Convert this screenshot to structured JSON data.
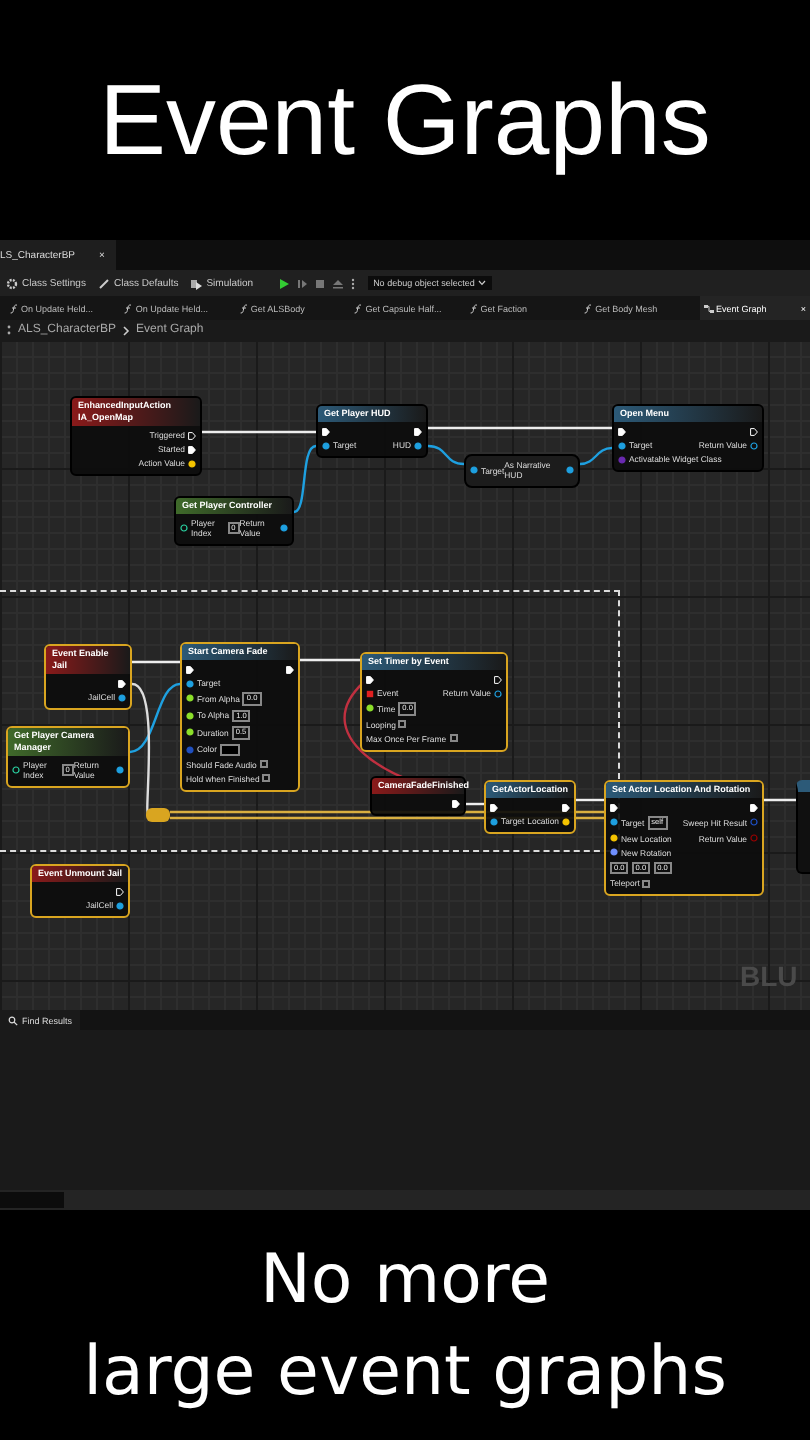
{
  "caption_top": "Event Graphs",
  "editor": {
    "document_tab": {
      "label": "LS_CharacterBP",
      "close": "×",
      "selected": true
    },
    "toolbar": {
      "buttons": [
        "Class Settings",
        "Class Defaults",
        "Simulation"
      ],
      "debug_dropdown": "No debug object selected"
    },
    "graph_tabs": [
      {
        "label": "On Update Held...",
        "kind": "function",
        "selected": false
      },
      {
        "label": "On Update Held...",
        "kind": "function",
        "selected": false
      },
      {
        "label": "Get ALSBody",
        "kind": "function",
        "selected": false
      },
      {
        "label": "Get Capsule Half...",
        "kind": "function",
        "selected": false
      },
      {
        "label": "Get Faction",
        "kind": "function",
        "selected": false
      },
      {
        "label": "Get Body Mesh",
        "kind": "function",
        "selected": false
      },
      {
        "label": "Event Graph",
        "kind": "graph",
        "selected": true,
        "close": "×"
      }
    ],
    "breadcrumb": [
      "ALS_CharacterBP",
      "Event Graph"
    ],
    "graph": {
      "nodes": [
        {
          "kind": "event",
          "title": "EnhancedInputAction IA_OpenMap",
          "rows": [
            {
              "right": {
                "kind": "exec_hollow",
                "label": "Triggered"
              }
            },
            {
              "right": {
                "kind": "exec",
                "label": "Started"
              }
            },
            {
              "right": {
                "kind": "struct",
                "label": "Action Value"
              }
            }
          ]
        },
        {
          "kind": "function",
          "title": "Get Player HUD",
          "rows": [
            {
              "left": {
                "kind": "exec"
              },
              "right": {
                "kind": "exec"
              }
            },
            {
              "left": {
                "kind": "object",
                "label": "Target"
              },
              "right": {
                "kind": "object",
                "label": "HUD"
              }
            }
          ]
        },
        {
          "kind": "function",
          "title": "Open Menu",
          "rows": [
            {
              "left": {
                "kind": "exec"
              },
              "right": {
                "kind": "exec_hollow"
              }
            },
            {
              "left": {
                "kind": "object",
                "label": "Target"
              },
              "right": {
                "kind": "object_hollow",
                "label": "Return Value"
              }
            },
            {
              "left": {
                "kind": "class",
                "label": "Activatable Widget Class"
              }
            }
          ]
        },
        {
          "kind": "compact",
          "rows": [
            {
              "left": {
                "kind": "object",
                "label": "Target"
              },
              "right": {
                "kind": "object",
                "label": "As Narrative HUD"
              }
            }
          ]
        },
        {
          "kind": "pure",
          "title": "Get Player Controller",
          "rows": [
            {
              "left": {
                "kind": "int_hollow",
                "label": "Player Index",
                "value": "0"
              },
              "right": {
                "kind": "object",
                "label": "Return Value"
              }
            }
          ]
        },
        {
          "kind": "event",
          "title": "Event Enable Jail",
          "rows": [
            {
              "right": {
                "kind": "exec"
              }
            },
            {
              "right": {
                "kind": "object",
                "label": "JailCell"
              }
            }
          ]
        },
        {
          "kind": "pure",
          "title": "Get Player Camera Manager",
          "rows": [
            {
              "left": {
                "kind": "int_hollow",
                "label": "Player Index",
                "value": "0"
              },
              "right": {
                "kind": "object",
                "label": "Return Value"
              }
            }
          ]
        },
        {
          "kind": "function",
          "title": "Start Camera Fade",
          "rows": [
            {
              "left": {
                "kind": "exec"
              },
              "right": {
                "kind": "exec"
              }
            },
            {
              "left": {
                "kind": "object",
                "label": "Target"
              }
            },
            {
              "left": {
                "kind": "float",
                "label": "From Alpha",
                "value": "0.0"
              }
            },
            {
              "left": {
                "kind": "float",
                "label": "To Alpha",
                "value": "1.0"
              }
            },
            {
              "left": {
                "kind": "float",
                "label": "Duration",
                "value": "0.5"
              }
            },
            {
              "left": {
                "kind": "color",
                "label": "Color"
              }
            },
            {
              "left": {
                "kind": "bool",
                "label": "Should Fade Audio",
                "checked": false
              }
            },
            {
              "left": {
                "kind": "bool",
                "label": "Hold when Finished",
                "checked": false
              }
            }
          ]
        },
        {
          "kind": "function",
          "title": "Set Timer by Event",
          "rows": [
            {
              "left": {
                "kind": "exec"
              },
              "right": {
                "kind": "exec_hollow"
              }
            },
            {
              "left": {
                "kind": "delegate",
                "label": "Event"
              },
              "right": {
                "kind": "object_hollow",
                "label": "Return Value"
              }
            },
            {
              "left": {
                "kind": "float",
                "label": "Time",
                "value": "0.0"
              }
            },
            {
              "left": {
                "kind": "bool",
                "label": "Looping",
                "checked": false
              }
            },
            {
              "left": {
                "kind": "bool",
                "label": "Max Once Per Frame",
                "checked": false
              }
            }
          ]
        },
        {
          "kind": "event",
          "title": "CameraFadeFinished",
          "rows": [
            {
              "right": {
                "kind": "exec"
              }
            }
          ]
        },
        {
          "kind": "function",
          "title": "GetActorLocation",
          "rows": [
            {
              "left": {
                "kind": "exec"
              },
              "right": {
                "kind": "exec"
              }
            },
            {
              "left": {
                "kind": "object",
                "label": "Target"
              },
              "right": {
                "kind": "struct",
                "label": "Location"
              }
            }
          ]
        },
        {
          "kind": "function",
          "title": "Set Actor Location And Rotation",
          "rows": [
            {
              "left": {
                "kind": "exec"
              },
              "right": {
                "kind": "exec"
              }
            },
            {
              "left": {
                "kind": "object",
                "label": "Target",
                "value": "self"
              },
              "right": {
                "kind": "struct_hollow",
                "label": "Sweep Hit Result"
              }
            },
            {
              "left": {
                "kind": "struct",
                "label": "New Location"
              },
              "right": {
                "kind": "bool_hollow",
                "label": "Return Value"
              }
            },
            {
              "left": {
                "kind": "rotator",
                "label": "New Rotation"
              }
            },
            {
              "left": {
                "kind": "rotator_values",
                "values": [
                  "0.0",
                  "0.0",
                  "0.0"
                ]
              }
            },
            {
              "left": {
                "kind": "bool",
                "label": "Teleport",
                "checked": false
              }
            }
          ]
        },
        {
          "kind": "event",
          "title": "Event Unmount Jail",
          "rows": [
            {
              "right": {
                "kind": "exec_hollow"
              }
            },
            {
              "right": {
                "kind": "object",
                "label": "JailCell"
              }
            }
          ]
        }
      ],
      "watermark": "BLU"
    },
    "find_results_tab": "Find Results"
  },
  "caption_bottom": [
    "No more",
    "large event graphs"
  ]
}
